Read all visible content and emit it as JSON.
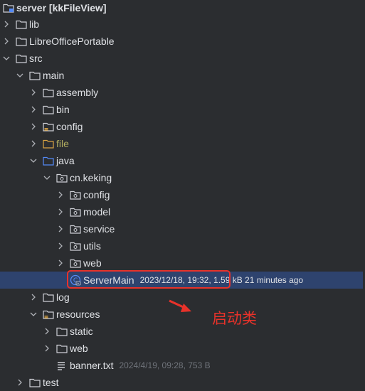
{
  "tree": {
    "root": {
      "label": "server [kkFileView]"
    },
    "items": [
      {
        "label": "lib"
      },
      {
        "label": "LibreOfficePortable"
      },
      {
        "label": "src"
      },
      {
        "label": "main"
      },
      {
        "label": "assembly"
      },
      {
        "label": "bin"
      },
      {
        "label": "config"
      },
      {
        "label": "file"
      },
      {
        "label": "java"
      },
      {
        "label": "cn.keking"
      },
      {
        "label": "config"
      },
      {
        "label": "model"
      },
      {
        "label": "service"
      },
      {
        "label": "utils"
      },
      {
        "label": "web"
      },
      {
        "label": "ServerMain",
        "meta": "2023/12/18, 19:32, 1.59 kB 21 minutes ago"
      },
      {
        "label": "log"
      },
      {
        "label": "resources"
      },
      {
        "label": "static"
      },
      {
        "label": "web"
      },
      {
        "label": "banner.txt",
        "meta": "2024/4/19, 09:28, 753 B"
      },
      {
        "label": "test"
      }
    ]
  },
  "annotation": {
    "text": "启动类"
  },
  "colors": {
    "background": "#2b2d30",
    "selected_row": "#2e436e",
    "highlight": "#e8322a",
    "folder": "#ced0d6",
    "source_folder": "#548af7",
    "resource_folder": "#d9a343",
    "excluded_folder": "#b3ae60"
  },
  "icons": {
    "root": "module-folder-icon",
    "folder": "folder-icon",
    "package": "package-icon",
    "source_root": "source-folder-icon",
    "resources_root": "resources-folder-icon",
    "class": "java-class-icon",
    "text_file": "text-file-icon"
  }
}
